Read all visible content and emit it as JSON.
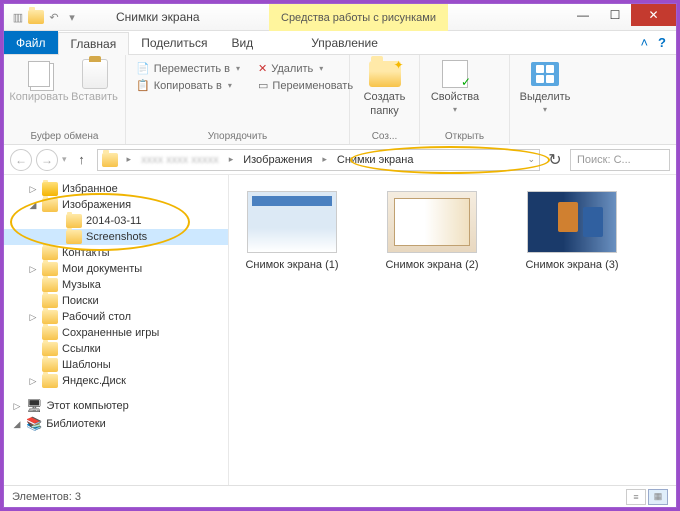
{
  "title": "Снимки экрана",
  "context_tab": "Средства работы с рисунками",
  "win": {
    "min": "—",
    "max": "☐",
    "close": "✕"
  },
  "tabs": {
    "file": "Файл",
    "home": "Главная",
    "share": "Поделиться",
    "view": "Вид",
    "manage": "Управление"
  },
  "ribbon": {
    "clipboard": {
      "copy": "Копировать",
      "paste": "Вставить",
      "group": "Буфер обмена"
    },
    "organize": {
      "moveto": "Переместить в",
      "copyto": "Копировать в",
      "delete": "Удалить",
      "rename": "Переименовать",
      "group": "Упорядочить"
    },
    "new": {
      "newfolder_l1": "Создать",
      "newfolder_l2": "папку",
      "group": "Соз..."
    },
    "open": {
      "properties": "Свойства",
      "group": "Открыть"
    },
    "select": {
      "select": "Выделить",
      "group": ""
    }
  },
  "address": {
    "blurred": "xxxx xxxx xxxxx",
    "seg1": "Изображения",
    "seg2": "Снимки экрана"
  },
  "search_placeholder": "Поиск: С...",
  "tree": {
    "favorites": "Избранное",
    "images": "Изображения",
    "date_folder": "2014-03-11",
    "screenshots": "Screenshots",
    "contacts": "Контакты",
    "documents": "Мои документы",
    "music": "Музыка",
    "searches": "Поиски",
    "desktop": "Рабочий стол",
    "saved_games": "Сохраненные игры",
    "links": "Ссылки",
    "templates": "Шаблоны",
    "yadisk": "Яндекс.Диск",
    "thispc": "Этот компьютер",
    "libraries": "Библиотеки"
  },
  "thumbs": [
    {
      "name": "Снимок экрана (1)"
    },
    {
      "name": "Снимок экрана (2)"
    },
    {
      "name": "Снимок экрана (3)"
    }
  ],
  "status": "Элементов: 3"
}
